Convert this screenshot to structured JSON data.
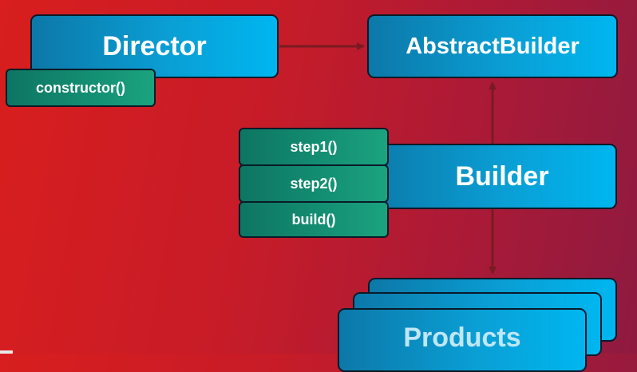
{
  "director": {
    "label": "Director",
    "method": "constructor()"
  },
  "abstract_builder": {
    "label": "AbstractBuilder"
  },
  "builder": {
    "label": "Builder",
    "methods": [
      "step1()",
      "step2()",
      "build()"
    ]
  },
  "products": {
    "label": "Products"
  },
  "colors": {
    "background_start": "#d81e1e",
    "background_end": "#8e1a40",
    "class_box": "#0a9ed4",
    "method_box": "#138e72",
    "arrow": "#7a1a22",
    "border": "#0b1a28"
  }
}
